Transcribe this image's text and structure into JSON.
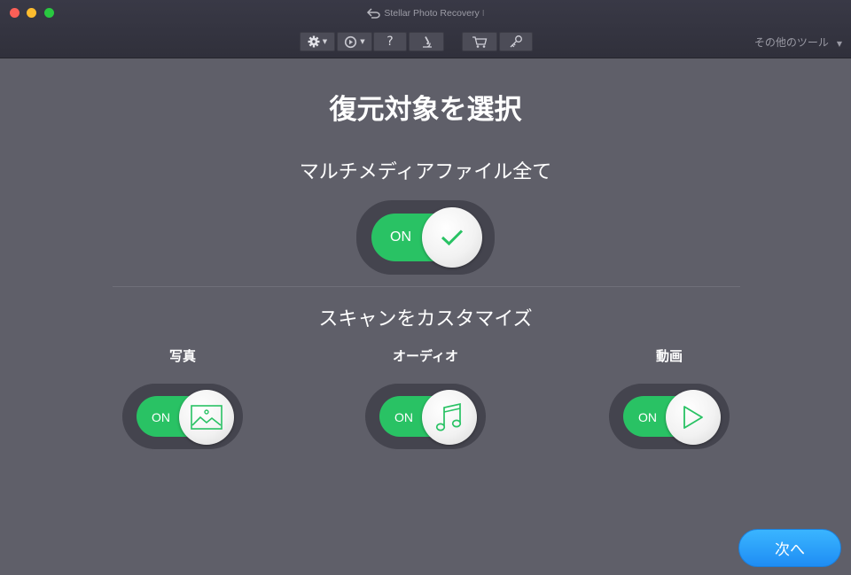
{
  "window": {
    "title": "Stellar Photo Recovery",
    "title_suffix": "I"
  },
  "toolbar": {
    "buttons": [
      {
        "icon": "gear-icon",
        "has_dropdown": true
      },
      {
        "icon": "history-icon",
        "has_dropdown": true
      },
      {
        "icon": "help-icon",
        "label": "?"
      },
      {
        "icon": "microscope-icon"
      },
      {
        "icon": "cart-icon"
      },
      {
        "icon": "key-icon"
      }
    ],
    "tools_menu_label": "その他のツール",
    "tools_menu_caret": "▼"
  },
  "main": {
    "title": "復元対象を選択",
    "all_multimedia": {
      "label": "マルチメディアファイル全て",
      "state": "ON",
      "icon": "checkmark-icon"
    },
    "customize": {
      "label": "スキャンをカスタマイズ",
      "categories": [
        {
          "label": "写真",
          "state": "ON",
          "icon": "photo-icon"
        },
        {
          "label": "オーディオ",
          "state": "ON",
          "icon": "music-note-icon"
        },
        {
          "label": "動画",
          "state": "ON",
          "icon": "play-icon"
        }
      ]
    },
    "next_button": "次へ"
  },
  "colors": {
    "background": "#5f5f69",
    "titlebar": "#33333e",
    "toggle_on": "#29c264",
    "accent_blue": "#2a9ffa"
  }
}
